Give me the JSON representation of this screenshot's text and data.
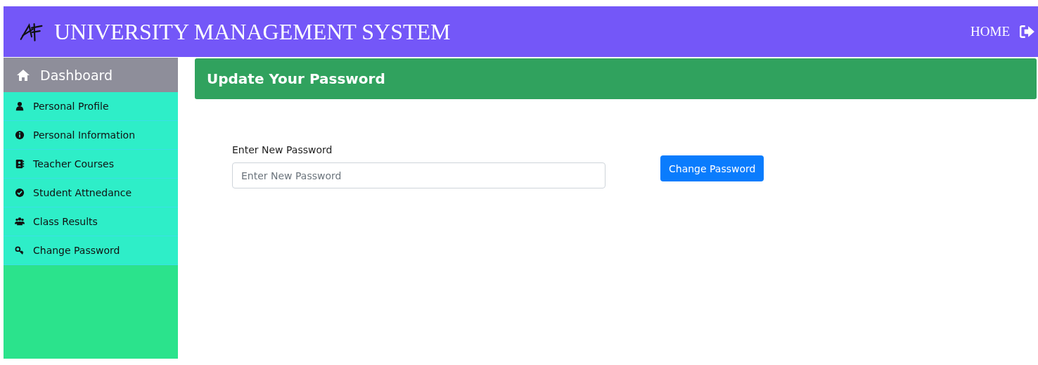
{
  "header": {
    "title": "UNIVERSITY MANAGEMENT SYSTEM",
    "home_link": "HOME"
  },
  "sidebar": {
    "dashboard": "Dashboard",
    "items": [
      {
        "label": "Personal Profile",
        "kind": "user"
      },
      {
        "label": "Personal Information",
        "kind": "info"
      },
      {
        "label": "Teacher Courses",
        "kind": "book"
      },
      {
        "label": "Student Attnedance",
        "kind": "check"
      },
      {
        "label": "Class Results",
        "kind": "users"
      },
      {
        "label": "Change Password",
        "kind": "key"
      }
    ]
  },
  "panel": {
    "title": "Update Your Password"
  },
  "form": {
    "label": "Enter New Password",
    "placeholder": "Enter New Password",
    "button": "Change Password"
  }
}
